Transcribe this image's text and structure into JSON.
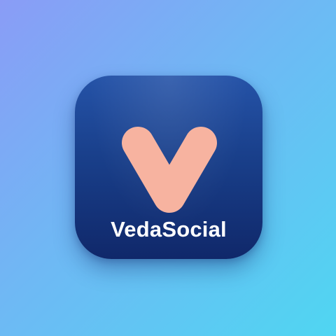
{
  "brand": {
    "name": "VedaSocial",
    "logo_icon": "v-letter-icon",
    "colors": {
      "background_start": "#8a9cf6",
      "background_end": "#4fd6f2",
      "icon_top": "#2553a8",
      "icon_bottom": "#10286a",
      "mark": "#f7b3a0",
      "text": "#ffffff"
    }
  }
}
